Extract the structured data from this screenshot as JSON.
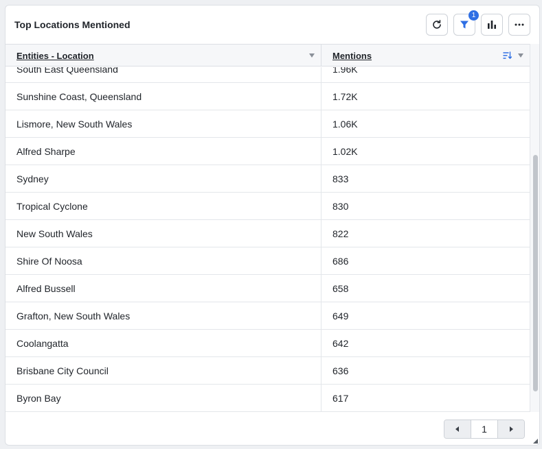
{
  "widget": {
    "title": "Top Locations Mentioned",
    "filter_badge": "1",
    "toolbar": {
      "icons": [
        "refresh-icon",
        "filter-icon",
        "bar-chart-icon",
        "more-icon"
      ]
    }
  },
  "table": {
    "columns": [
      "Entities - Location",
      "Mentions"
    ],
    "rows": [
      {
        "location": "South East Queensland",
        "mentions": "1.96K"
      },
      {
        "location": "Sunshine Coast, Queensland",
        "mentions": "1.72K"
      },
      {
        "location": "Lismore, New South Wales",
        "mentions": "1.06K"
      },
      {
        "location": "Alfred Sharpe",
        "mentions": "1.02K"
      },
      {
        "location": "Sydney",
        "mentions": "833"
      },
      {
        "location": "Tropical Cyclone",
        "mentions": "830"
      },
      {
        "location": "New South Wales",
        "mentions": "822"
      },
      {
        "location": "Shire Of Noosa",
        "mentions": "686"
      },
      {
        "location": "Alfred Bussell",
        "mentions": "658"
      },
      {
        "location": "Grafton, New South Wales",
        "mentions": "649"
      },
      {
        "location": "Coolangatta",
        "mentions": "642"
      },
      {
        "location": "Brisbane City Council",
        "mentions": "636"
      },
      {
        "location": "Byron Bay",
        "mentions": "617"
      }
    ]
  },
  "pagination": {
    "current_page": "1"
  },
  "colors": {
    "accent": "#2f6fe4",
    "border": "#dcdfe4"
  }
}
